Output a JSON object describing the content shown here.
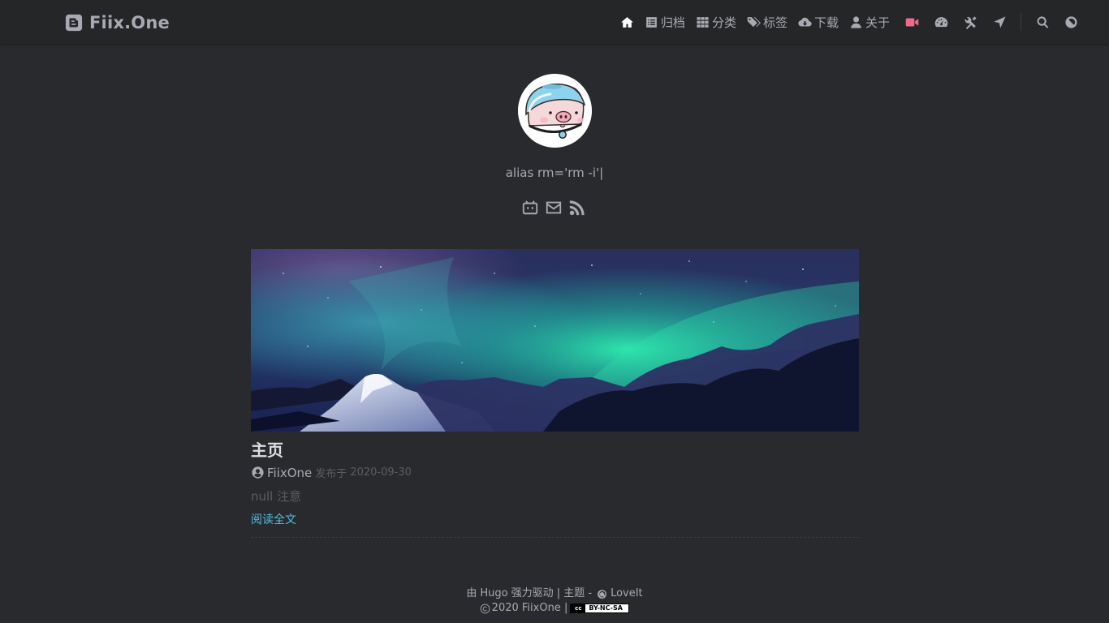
{
  "header": {
    "logo_text": "Fiix.One",
    "nav": [
      {
        "icon": "home-icon",
        "label": ""
      },
      {
        "icon": "archive-icon",
        "label": "归档"
      },
      {
        "icon": "grid-icon",
        "label": "分类"
      },
      {
        "icon": "tags-icon",
        "label": "标签"
      },
      {
        "icon": "cloud-download-icon",
        "label": "下载"
      },
      {
        "icon": "user-icon",
        "label": "关于"
      },
      {
        "icon": "video-icon",
        "label": ""
      },
      {
        "icon": "dashboard-icon",
        "label": ""
      },
      {
        "icon": "tools-icon",
        "label": ""
      },
      {
        "icon": "location-arrow-icon",
        "label": ""
      },
      {
        "icon": "search-icon",
        "label": ""
      },
      {
        "icon": "theme-switch-icon",
        "label": ""
      }
    ]
  },
  "profile": {
    "subtitle": "alias rm='rm -i'|",
    "social": [
      "bilibili-icon",
      "email-icon",
      "rss-icon"
    ]
  },
  "post": {
    "title": "主页",
    "author": "FiixOne",
    "published_label": "发布于",
    "date": "2020-09-30",
    "summary": "null 注意",
    "read_more": "阅读全文"
  },
  "footer": {
    "powered_prefix": "由",
    "hugo": "Hugo",
    "powered_suffix": "强力驱动 | 主题 -",
    "theme_name": "LoveIt",
    "copyright": "2020 FiixOne |",
    "license": "BY-NC-SA",
    "license_cc": "cc"
  },
  "colors": {
    "background": "#292a2d",
    "header": "#252627",
    "text": "#a9a9b3",
    "link": "#55bde2",
    "video_accent": "#f0688c"
  }
}
